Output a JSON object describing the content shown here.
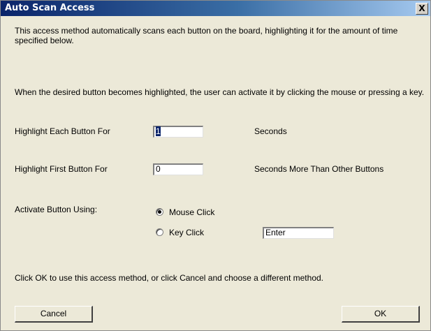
{
  "window": {
    "title": "Auto Scan Access",
    "close_label": "X"
  },
  "intro": {
    "p1": "This access method automatically scans each button on the board, highlighting it for the amount of time specified below.",
    "p2": "When the desired button becomes highlighted, the user can activate it by clicking the mouse or pressing a key."
  },
  "settings": {
    "highlight_each_label": "Highlight Each Button For",
    "highlight_each_value": "1",
    "highlight_each_unit": "Seconds",
    "highlight_first_label": "Highlight First Button For",
    "highlight_first_value": "0",
    "highlight_first_unit": "Seconds More Than Other Buttons",
    "activate_label": "Activate Button Using:",
    "option_mouse": "Mouse Click",
    "option_key": "Key Click",
    "selected_option": "Mouse Click",
    "key_value": "Enter"
  },
  "footer": {
    "instruction": "Click OK to use this access method,  or click Cancel and choose a different method.",
    "cancel_label": "Cancel",
    "ok_label": "OK"
  }
}
